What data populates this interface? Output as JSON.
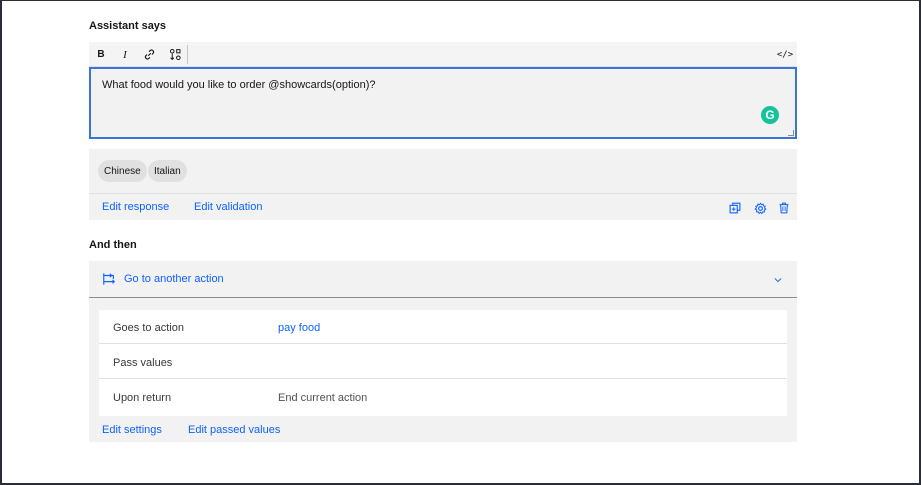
{
  "assistant_says": {
    "title": "Assistant says",
    "toolbar": {
      "bold_label": "B",
      "italic_label": "I",
      "link_icon": "link-icon",
      "variable_icon": "variable-icon",
      "code_view_label": "</>"
    },
    "message_text": "What food would you like to order @showcards(option)?",
    "grammarly_label": "G",
    "options": [
      "Chinese",
      "Italian"
    ],
    "edit_response_label": "Edit response",
    "edit_validation_label": "Edit validation",
    "action_icons": [
      "duplicate-icon",
      "settings-icon",
      "delete-icon"
    ]
  },
  "and_then": {
    "title": "And then",
    "dropdown_label": "Go to another action",
    "details": [
      {
        "label": "Goes to action",
        "value": "pay food"
      },
      {
        "label": "Pass values",
        "value": ""
      },
      {
        "label": "Upon return",
        "value": "End current action"
      }
    ],
    "edit_settings_label": "Edit settings",
    "edit_passed_values_label": "Edit passed values"
  },
  "colors": {
    "link": "#0f62fe",
    "focus_border": "#3a75d6",
    "panel_bg": "#f2f2f2",
    "grammarly": "#15c39a"
  }
}
